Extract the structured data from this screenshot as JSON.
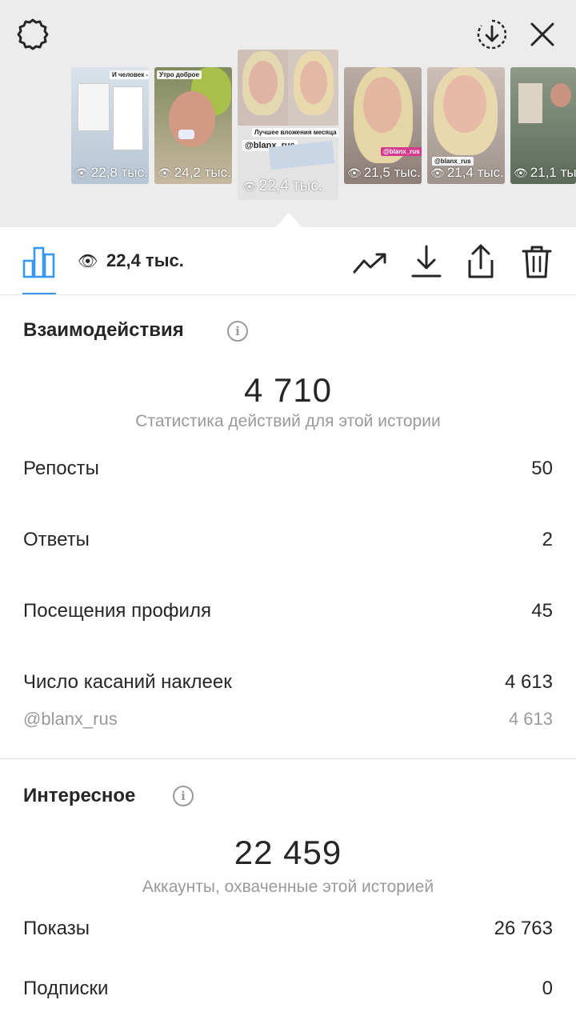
{
  "top": {
    "stories": [
      {
        "views": "22,8 тыс.",
        "active": false
      },
      {
        "views": "24,2 тыс.",
        "active": false
      },
      {
        "views": "22,4 тыс.",
        "active": true
      },
      {
        "views": "21,5 тыс.",
        "active": false
      },
      {
        "views": "21,4 тыс.",
        "active": false
      },
      {
        "views": "21,1 тыс.",
        "active": false
      }
    ]
  },
  "toolbar": {
    "views_count": "22,4 тыс.",
    "accent": "#3897f0"
  },
  "interactions": {
    "title": "Взаимодействия",
    "total": "4 710",
    "subtitle": "Статистика действий для этой истории",
    "rows": [
      {
        "label": "Репосты",
        "value": "50"
      },
      {
        "label": "Ответы",
        "value": "2"
      },
      {
        "label": "Посещения профиля",
        "value": "45"
      },
      {
        "label": "Число касаний наклеек",
        "value": "4 613"
      }
    ],
    "sticker": {
      "label": "@blanx_rus",
      "value": "4 613"
    }
  },
  "discovery": {
    "title": "Интересное",
    "total": "22 459",
    "subtitle": "Аккаунты, охваченные этой историей",
    "rows": [
      {
        "label": "Показы",
        "value": "26 763"
      },
      {
        "label": "Подписки",
        "value": "0"
      }
    ]
  },
  "info_icon_glyph": "i"
}
